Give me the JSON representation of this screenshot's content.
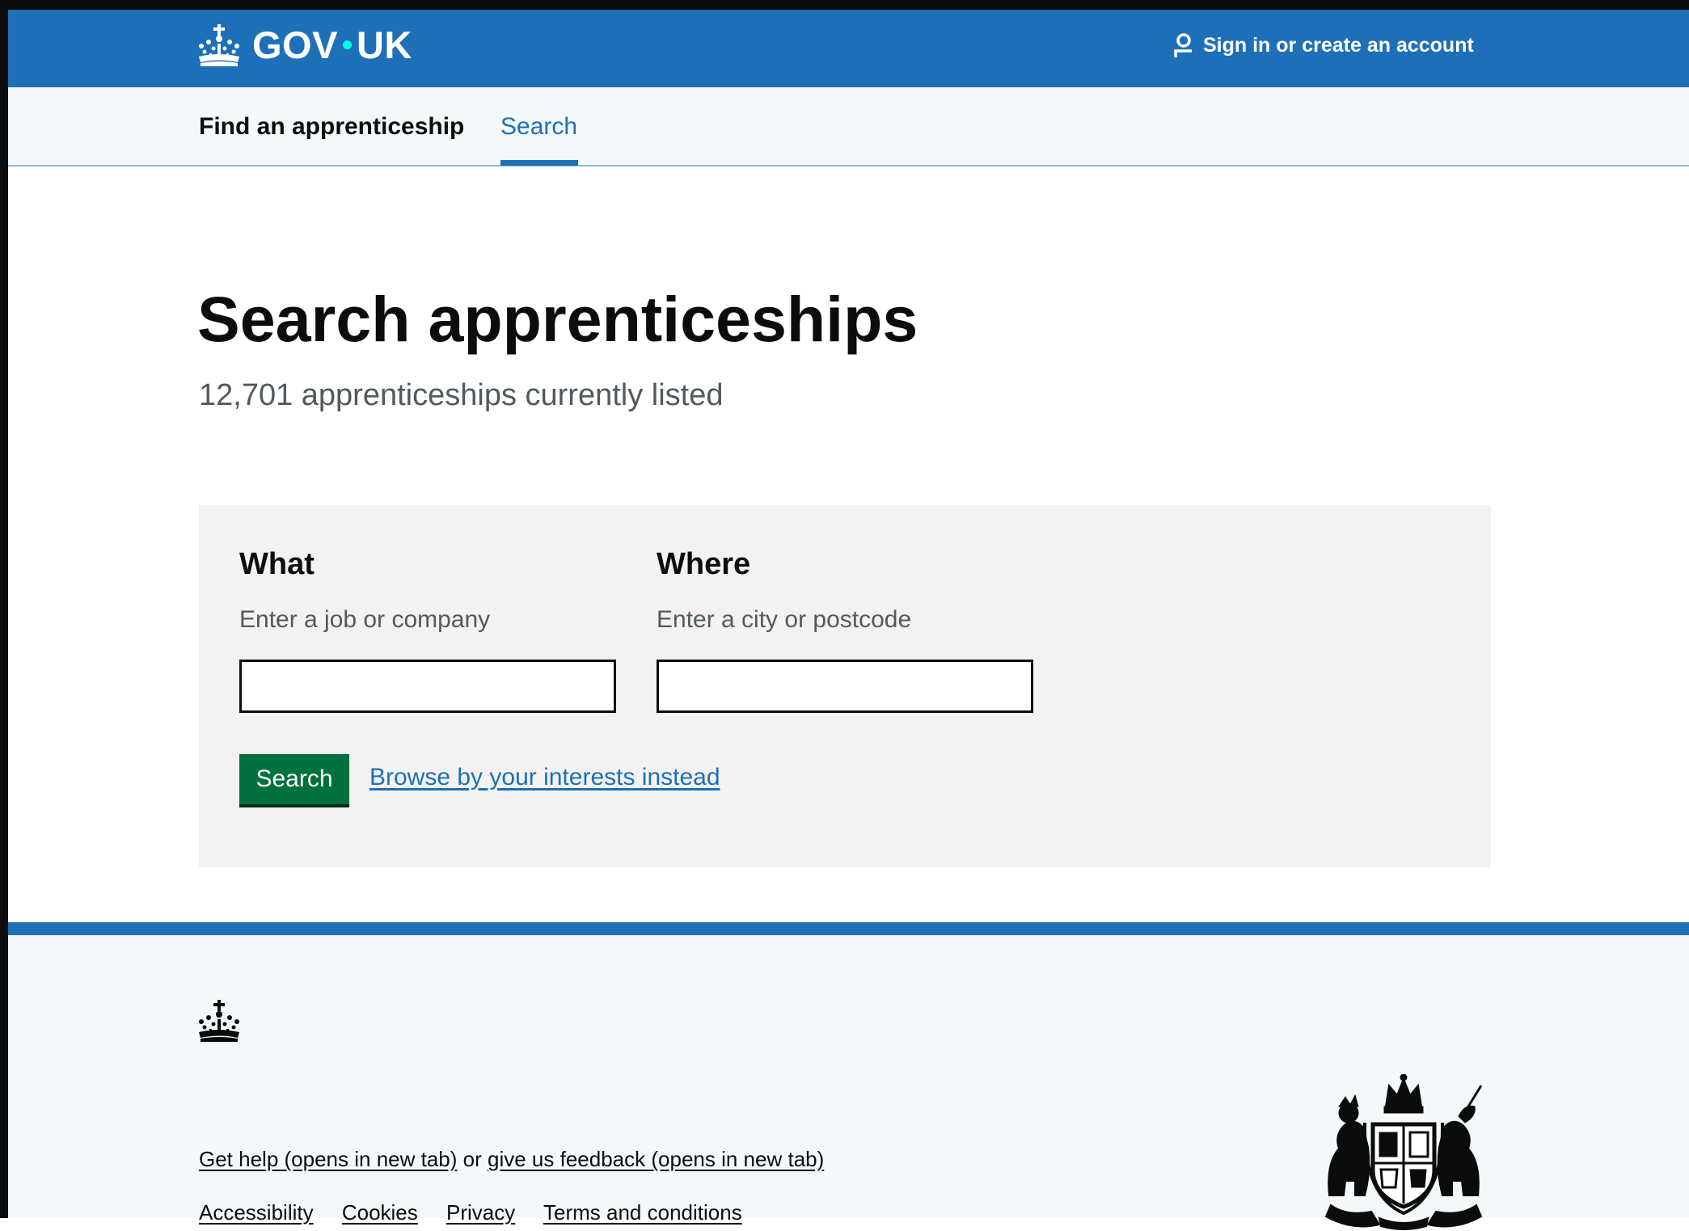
{
  "header": {
    "logo_text_left": "GOV",
    "logo_text_right": "UK",
    "signin_label": "Sign in or create an account"
  },
  "service_nav": {
    "service_name": "Find an apprenticeship",
    "items": [
      {
        "label": "Search",
        "active": true
      }
    ]
  },
  "main": {
    "title": "Search apprenticeships",
    "subtitle": "12,701 apprenticeships currently listed",
    "search_form": {
      "what": {
        "label": "What",
        "hint": "Enter a job or company",
        "value": ""
      },
      "where": {
        "label": "Where",
        "hint": "Enter a city or postcode",
        "value": ""
      },
      "submit_label": "Search",
      "browse_link": "Browse by your interests instead"
    }
  },
  "footer": {
    "help_link": "Get help (opens in new tab)",
    "or_text": "or",
    "feedback_link": "give us feedback (opens in new tab)",
    "links": [
      "Accessibility",
      "Cookies",
      "Privacy",
      "Terms and conditions"
    ]
  },
  "colors": {
    "brand_blue": "#1d70b8",
    "button_green": "#00703c",
    "text": "#0b0c0c",
    "secondary_text": "#505a5f",
    "panel_grey": "#f3f2f1",
    "footer_bg": "#f4f8fb",
    "logo_dot": "#00ffe0"
  },
  "icons": {
    "logo": "crown-icon",
    "signin": "user-icon",
    "footer_logo": "crown-icon",
    "footer_crest": "royal-coat-of-arms"
  }
}
